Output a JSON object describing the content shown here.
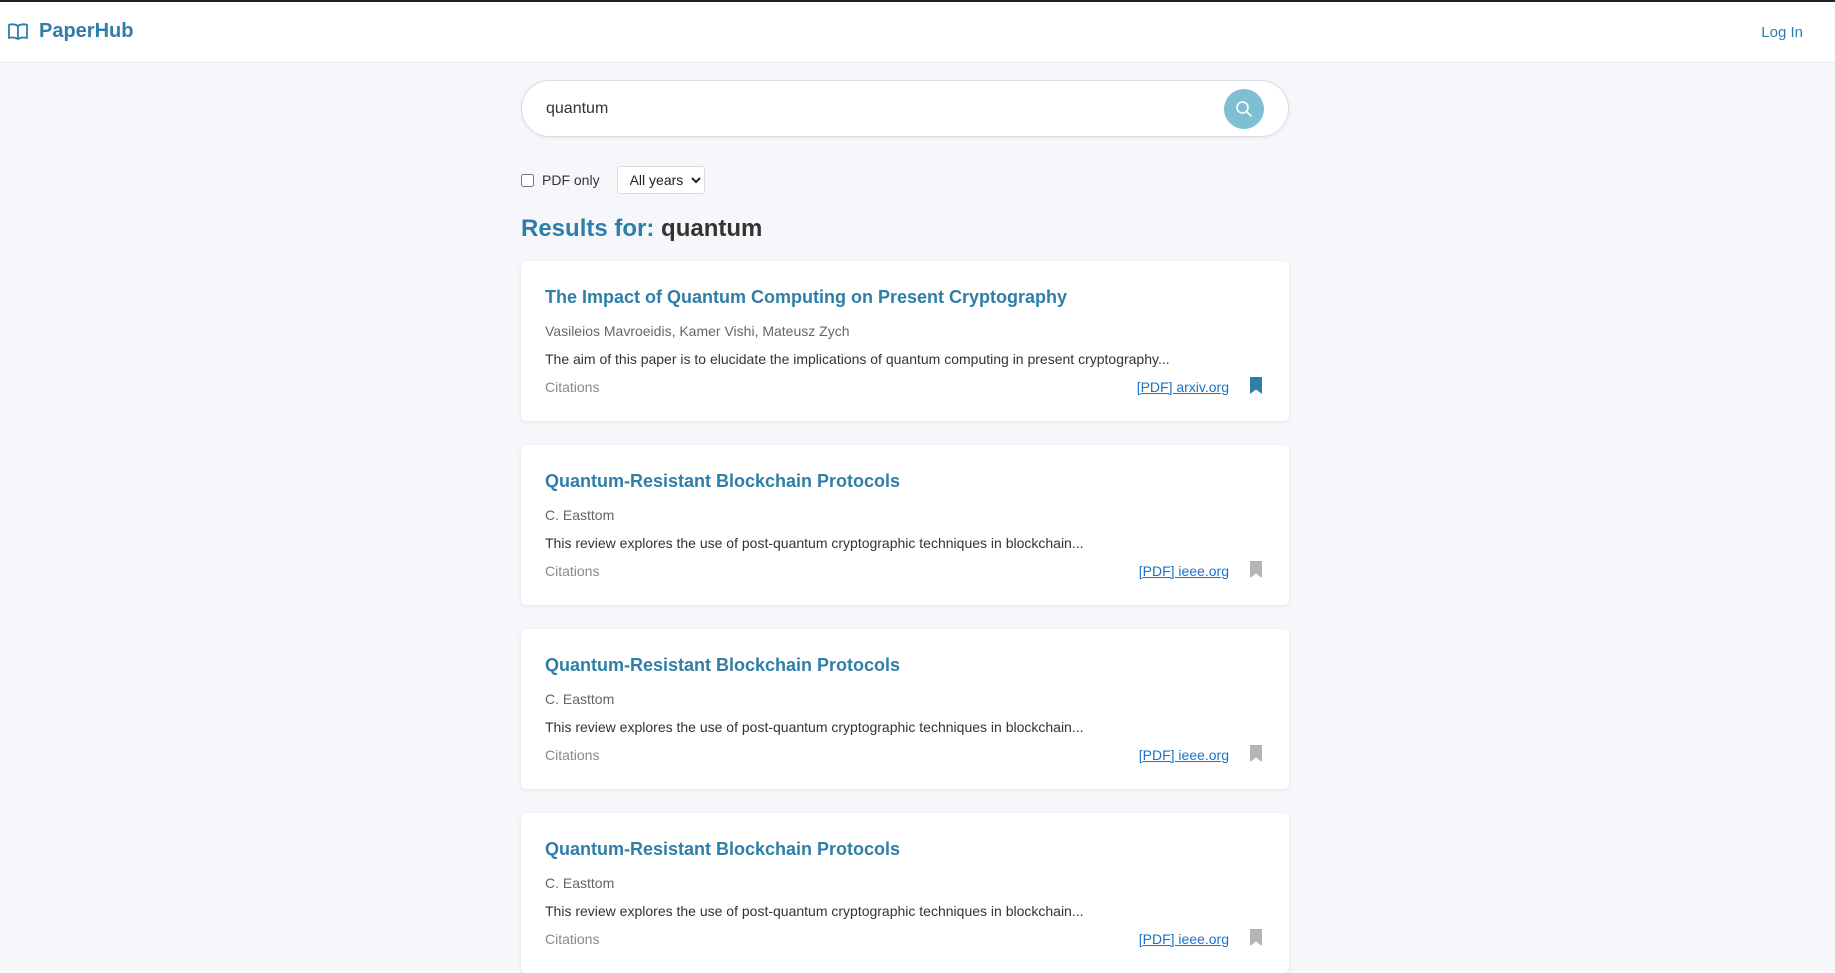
{
  "header": {
    "brand": "PaperHub",
    "login_label": "Log In"
  },
  "search": {
    "query": "quantum",
    "pdf_only_label": "PDF only",
    "year_selected": "All years"
  },
  "results": {
    "heading_prefix": "Results for:",
    "heading_query": "quantum",
    "items": [
      {
        "title": "The Impact of Quantum Computing on Present Cryptography",
        "authors": "Vasileios Mavroeidis, Kamer Vishi, Mateusz Zych",
        "abstract": "The aim of this paper is to elucidate the implications of quantum computing in present cryptography...",
        "citations": "Citations",
        "pdf": "[PDF] arxiv.org",
        "bookmarked": true
      },
      {
        "title": "Quantum-Resistant Blockchain Protocols",
        "authors": "C. Easttom",
        "abstract": "This review explores the use of post-quantum cryptographic techniques in blockchain...",
        "citations": "Citations",
        "pdf": "[PDF] ieee.org",
        "bookmarked": false
      },
      {
        "title": "Quantum-Resistant Blockchain Protocols",
        "authors": "C. Easttom",
        "abstract": "This review explores the use of post-quantum cryptographic techniques in blockchain...",
        "citations": "Citations",
        "pdf": "[PDF] ieee.org",
        "bookmarked": false
      },
      {
        "title": "Quantum-Resistant Blockchain Protocols",
        "authors": "C. Easttom",
        "abstract": "This review explores the use of post-quantum cryptographic techniques in blockchain...",
        "citations": "Citations",
        "pdf": "[PDF] ieee.org",
        "bookmarked": false
      }
    ]
  },
  "colors": {
    "accent": "#2f7ea8",
    "bookmark_active": "#2f7ea8",
    "bookmark_inactive": "#b5b5b5",
    "search_button": "#7fbfd4"
  },
  "icons": {
    "brand": "open-book-icon",
    "search": "search-icon",
    "bookmark": "bookmark-icon"
  }
}
